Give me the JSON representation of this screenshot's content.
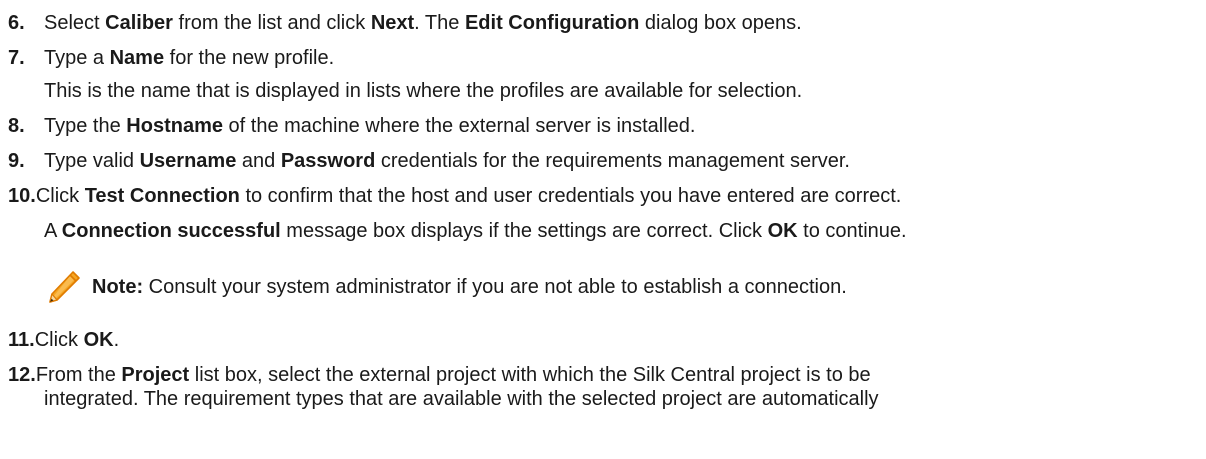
{
  "steps": [
    {
      "number": "6.",
      "parts": [
        {
          "t": "Select ",
          "b": false
        },
        {
          "t": "Caliber",
          "b": true
        },
        {
          "t": " from the list and click ",
          "b": false
        },
        {
          "t": "Next",
          "b": true
        },
        {
          "t": ". The ",
          "b": false
        },
        {
          "t": "Edit Configuration",
          "b": true
        },
        {
          "t": " dialog box opens.",
          "b": false
        }
      ]
    },
    {
      "number": "7.",
      "parts": [
        {
          "t": "Type a ",
          "b": false
        },
        {
          "t": "Name",
          "b": true
        },
        {
          "t": " for the new profile.",
          "b": false
        }
      ],
      "subtext": "This is the name that is displayed in lists where the profiles are available for selection."
    },
    {
      "number": "8.",
      "parts": [
        {
          "t": "Type the ",
          "b": false
        },
        {
          "t": "Hostname",
          "b": true
        },
        {
          "t": " of the machine where the external server is installed.",
          "b": false
        }
      ]
    },
    {
      "number": "9.",
      "parts": [
        {
          "t": "Type valid ",
          "b": false
        },
        {
          "t": "Username",
          "b": true
        },
        {
          "t": " and ",
          "b": false
        },
        {
          "t": "Password",
          "b": true
        },
        {
          "t": " credentials for the requirements management server.",
          "b": false
        }
      ]
    },
    {
      "number": "10.",
      "parts": [
        {
          "t": "Click ",
          "b": false
        },
        {
          "t": "Test Connection",
          "b": true
        },
        {
          "t": " to confirm that the host and user credentials you have entered are correct.",
          "b": false
        }
      ],
      "subparts": [
        {
          "t": "A ",
          "b": false
        },
        {
          "t": "Connection successful",
          "b": true
        },
        {
          "t": " message box displays if the settings are correct. Click ",
          "b": false
        },
        {
          "t": "OK",
          "b": true
        },
        {
          "t": " to continue.",
          "b": false
        }
      ]
    },
    {
      "number": "11.",
      "parts": [
        {
          "t": "Click ",
          "b": false
        },
        {
          "t": "OK",
          "b": true
        },
        {
          "t": ".",
          "b": false
        }
      ]
    },
    {
      "number": "12.",
      "parts": [
        {
          "t": "From the ",
          "b": false
        },
        {
          "t": "Project",
          "b": true
        },
        {
          "t": " list box, select the external project with which the Silk Central project is to be",
          "b": false
        }
      ],
      "continuation": "integrated. The requirement types that are available with the selected project are automatically"
    }
  ],
  "note": {
    "label": "Note:",
    "text": " Consult your system administrator if you are not able to establish a connection.",
    "icon": "pencil-icon",
    "icon_colors": {
      "body": "#f5a623",
      "outline": "#e07b00",
      "tip": "#3a2a10"
    }
  }
}
